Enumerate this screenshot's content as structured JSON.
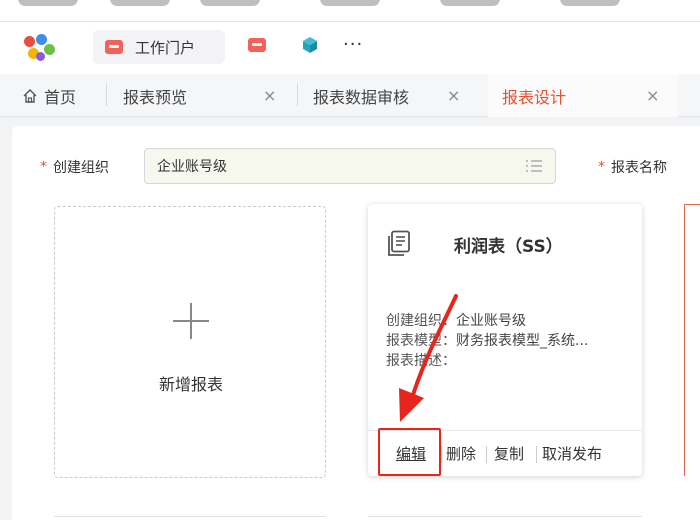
{
  "app": {
    "portal_tab_label": "工作门户",
    "more_label": "···"
  },
  "tabs": [
    {
      "label": "首页",
      "closable": false
    },
    {
      "label": "报表预览",
      "closable": true
    },
    {
      "label": "报表数据审核",
      "closable": true
    },
    {
      "label": "报表设计",
      "closable": true,
      "active": true
    }
  ],
  "close_glyph": "×",
  "form": {
    "org_label": "创建组织",
    "org_value": "企业账号级",
    "name_label": "报表名称",
    "required_mark": "*"
  },
  "new_report": {
    "label": "新增报表"
  },
  "report_card": {
    "title": "利润表（SS）",
    "org_key": "创建组织：",
    "org_value": "企业账号级",
    "model_key": "报表模型：",
    "model_value": "财务报表模型_系统...",
    "desc_key": "报表描述：",
    "desc_value": "",
    "actions": {
      "edit": "编辑",
      "delete": "删除",
      "copy": "复制",
      "unpublish": "取消发布"
    }
  },
  "colors": {
    "accent": "#e8502e",
    "highlight": "#e8241d",
    "brand_red": "#f2615a"
  },
  "icons": {
    "home": "home-icon",
    "list": "list-icon",
    "doc": "report-doc-icon",
    "plus": "plus-icon",
    "cube": "cube-icon"
  }
}
